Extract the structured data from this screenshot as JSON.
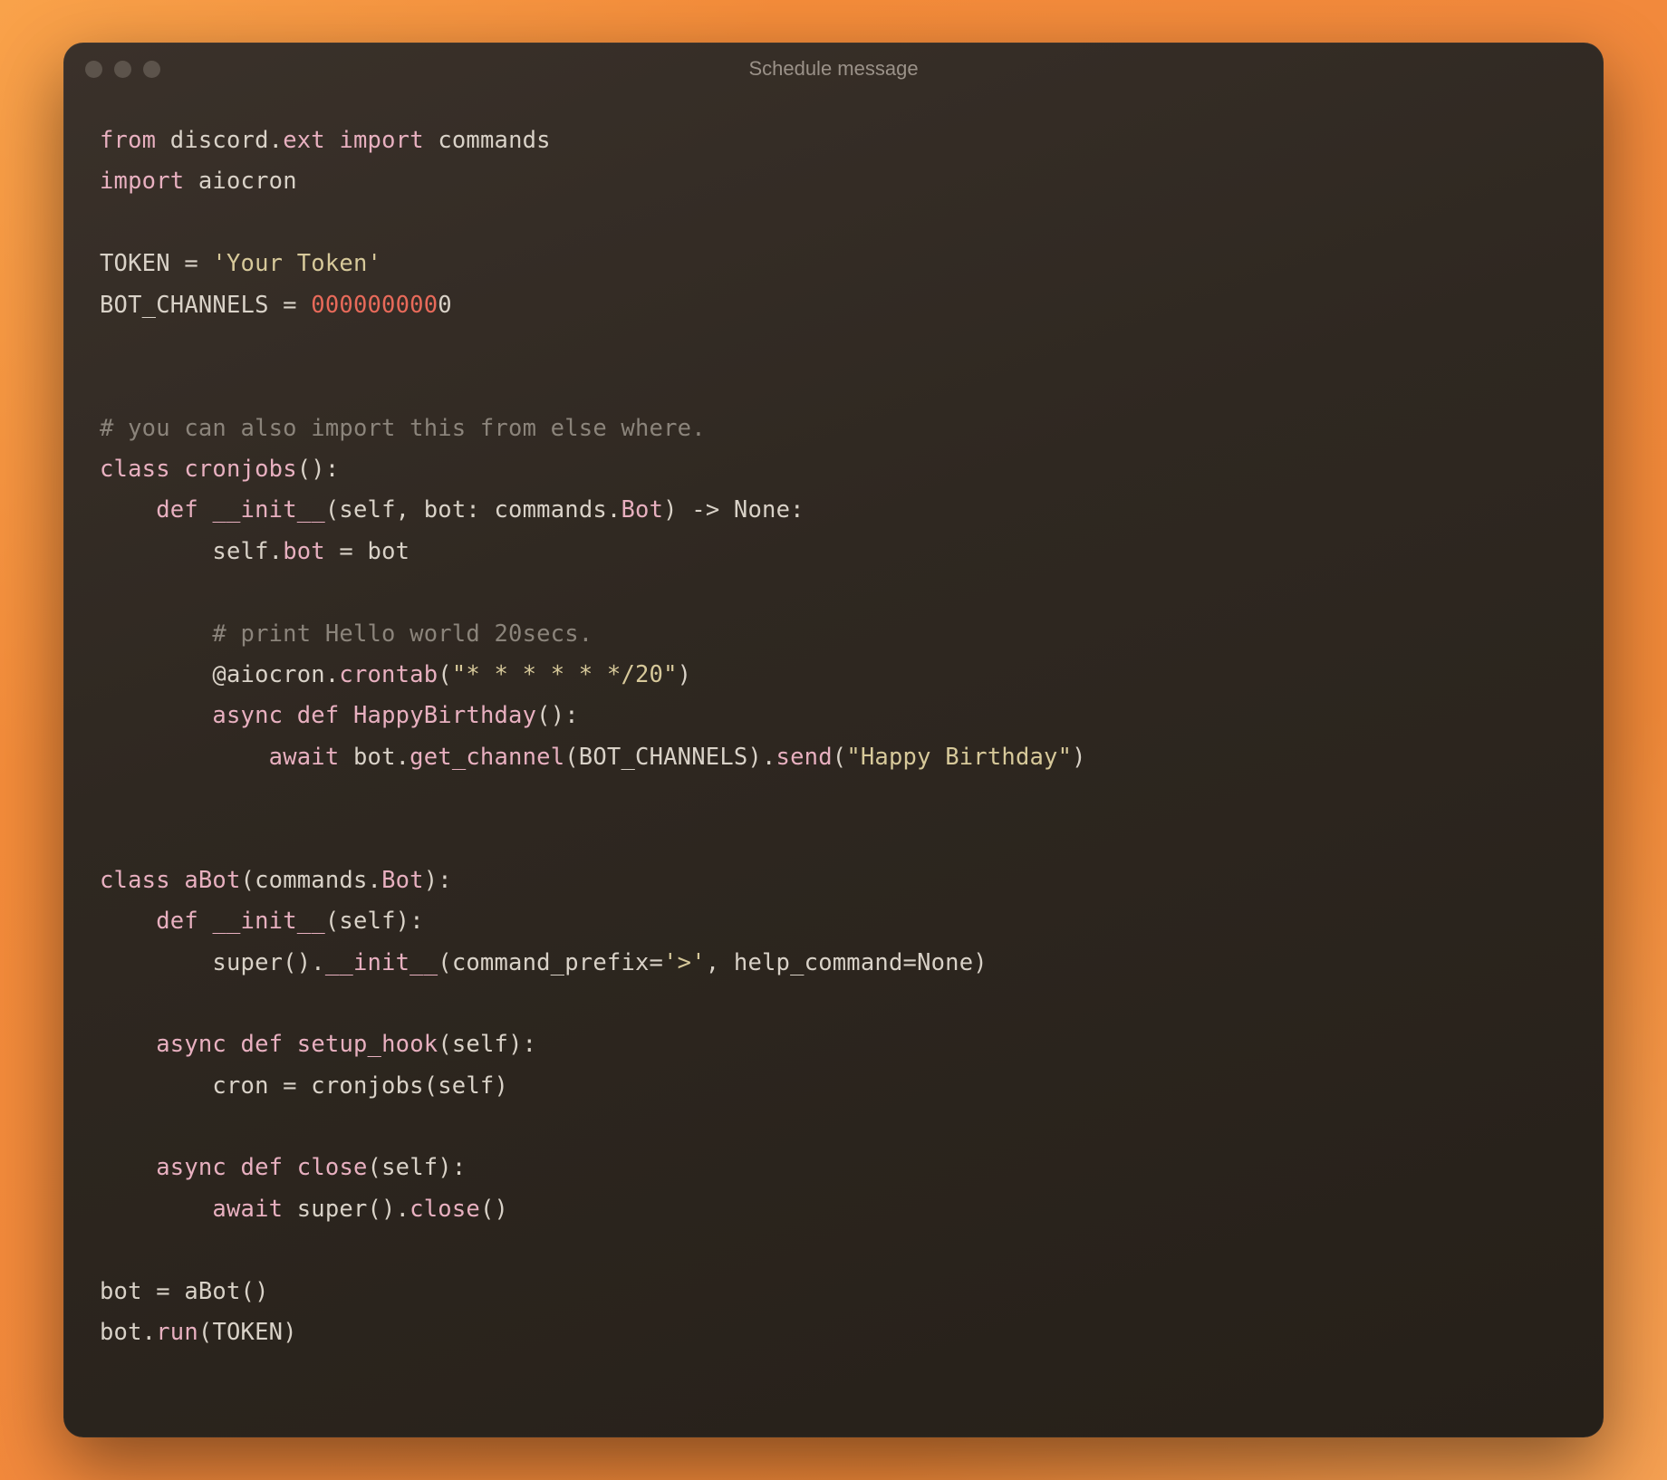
{
  "window": {
    "title": "Schedule message"
  },
  "code": {
    "l1a": "from",
    "l1b": " discord",
    "l1c": ".",
    "l1d": "ext",
    "l1e": " ",
    "l1f": "import",
    "l1g": " commands",
    "l2a": "import",
    "l2b": " aiocron",
    "l3": "",
    "l4a": "TOKEN = ",
    "l4b": "'Your Token'",
    "l5a": "BOT_CHANNELS = ",
    "l5b": "000000000",
    "l5c": "0",
    "l6": "",
    "l7": "",
    "l8": "# you can also import this from else where.",
    "l9a": "class",
    "l9b": " ",
    "l9c": "cronjobs",
    "l9d": "():",
    "l10a": "    ",
    "l10b": "def",
    "l10c": " ",
    "l10d": "__init__",
    "l10e": "(self, bot: commands.",
    "l10f": "Bot",
    "l10g": ") -> None:",
    "l11a": "        self.",
    "l11b": "bot",
    "l11c": " = bot",
    "l12": "",
    "l13a": "        ",
    "l13b": "# print Hello world 20secs.",
    "l14a": "        @aiocron.",
    "l14b": "crontab",
    "l14c": "(",
    "l14d": "\"* * * * * */20\"",
    "l14e": ")",
    "l15a": "        ",
    "l15b": "async",
    "l15c": " ",
    "l15d": "def",
    "l15e": " ",
    "l15f": "HappyBirthday",
    "l15g": "():",
    "l16a": "            ",
    "l16b": "await",
    "l16c": " bot.",
    "l16d": "get_channel",
    "l16e": "(BOT_CHANNELS).",
    "l16f": "send",
    "l16g": "(",
    "l16h": "\"Happy Birthday\"",
    "l16i": ")",
    "l17": "",
    "l18": "",
    "l19a": "class",
    "l19b": " ",
    "l19c": "aBot",
    "l19d": "(commands.",
    "l19e": "Bot",
    "l19f": "):",
    "l20a": "    ",
    "l20b": "def",
    "l20c": " ",
    "l20d": "__init__",
    "l20e": "(self):",
    "l21a": "        super().",
    "l21b": "__init__",
    "l21c": "(command_prefix=",
    "l21d": "'>'",
    "l21e": ", help_command=None)",
    "l22": "",
    "l23a": "    ",
    "l23b": "async",
    "l23c": " ",
    "l23d": "def",
    "l23e": " ",
    "l23f": "setup_hook",
    "l23g": "(self):",
    "l24a": "        cron = cronjobs(self)",
    "l25": "",
    "l26a": "    ",
    "l26b": "async",
    "l26c": " ",
    "l26d": "def",
    "l26e": " ",
    "l26f": "close",
    "l26g": "(self):",
    "l27a": "        ",
    "l27b": "await",
    "l27c": " super().",
    "l27d": "close",
    "l27e": "()",
    "l28": "",
    "l29": "bot = aBot()",
    "l30a": "bot.",
    "l30b": "run",
    "l30c": "(TOKEN)"
  }
}
